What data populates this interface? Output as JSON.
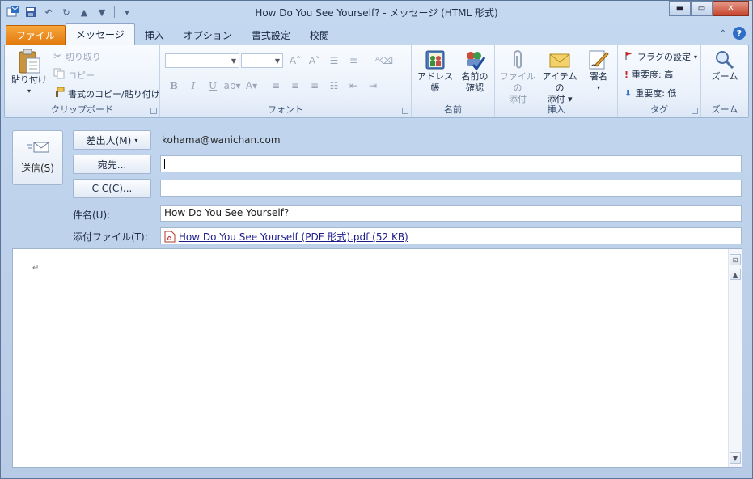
{
  "window": {
    "title": "How Do You See Yourself? - メッセージ (HTML 形式)",
    "min_label": "▬",
    "max_label": "▭",
    "close_label": "✕"
  },
  "tabs": [
    {
      "label": "ファイル"
    },
    {
      "label": "メッセージ"
    },
    {
      "label": "挿入"
    },
    {
      "label": "オプション"
    },
    {
      "label": "書式設定"
    },
    {
      "label": "校閲"
    }
  ],
  "ribbon": {
    "clipboard": {
      "paste": "貼り付け",
      "cut": "切り取り",
      "copy": "コピー",
      "format_painter": "書式のコピー/貼り付け",
      "label": "クリップボード"
    },
    "font": {
      "label": "フォント",
      "bold": "B",
      "italic": "I",
      "underline": "U"
    },
    "names": {
      "address_book": "アドレス帳",
      "check_names_line1": "名前の",
      "check_names_line2": "確認",
      "label": "名前"
    },
    "insert": {
      "attach_file_line1": "ファイルの",
      "attach_file_line2": "添付",
      "attach_item_line1": "アイテムの",
      "attach_item_line2": "添付",
      "signature": "署名",
      "label": "挿入"
    },
    "tags": {
      "follow_up": "フラグの設定",
      "high_importance": "重要度: 高",
      "low_importance": "重要度: 低",
      "label": "タグ"
    },
    "zoom": {
      "zoom": "ズーム",
      "label": "ズーム"
    }
  },
  "compose": {
    "send": "送信(S)",
    "from_button": "差出人(M)",
    "from_value": "kohama@wanichan.com",
    "to_button": "宛先...",
    "to_value": "",
    "cc_button": "C C(C)...",
    "cc_value": "",
    "subject_label": "件名(U):",
    "subject_value": "How Do You See Yourself?",
    "attached_label": "添付ファイル(T):",
    "attachment": "How Do You See Yourself (PDF 形式).pdf (52 KB)"
  },
  "body": {
    "paragraph_mark": "↵"
  },
  "colors": {
    "file_tab": "#e27a10",
    "accent": "#2f6ec7",
    "flag_red": "#c62828"
  }
}
